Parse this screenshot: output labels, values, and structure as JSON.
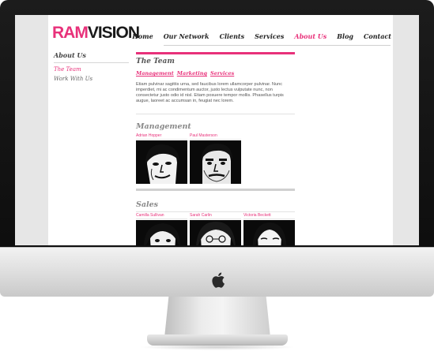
{
  "site": {
    "logo_primary": "RAM",
    "logo_secondary": "VISION",
    "brand_color": "#e8317a"
  },
  "nav": {
    "items": [
      {
        "label": "Home",
        "active": false
      },
      {
        "label": "Our Network",
        "active": false
      },
      {
        "label": "Clients",
        "active": false
      },
      {
        "label": "Services",
        "active": false
      },
      {
        "label": "About Us",
        "active": true
      },
      {
        "label": "Blog",
        "active": false
      },
      {
        "label": "Contact",
        "active": false
      }
    ]
  },
  "sidebar": {
    "title": "About Us",
    "items": [
      {
        "label": "The Team",
        "active": true
      },
      {
        "label": "Work With Us",
        "active": false
      }
    ]
  },
  "main": {
    "title": "The Team",
    "subnav": [
      "Management",
      "Marketing",
      "Services"
    ],
    "intro": "Etiam pulvinar sagittis urna, sed faucibus lorem ullamcorper pulvinar. Nunc imperdiet, mi ac condimentum auctor, justo lectus vulputate nunc, non consectetur justo odio id nisl. Etiam posuere tempor mollis. Phasellus turpis augue, laoreet ac accumsan in, feugiat nec lorem.",
    "management": {
      "title": "Management",
      "people": [
        {
          "name": "Adrian Hopper"
        },
        {
          "name": "Paul Masterson"
        }
      ]
    },
    "sales": {
      "title": "Sales",
      "people": [
        {
          "name": "Camilla Sullivan"
        },
        {
          "name": "Sarah Carlin"
        },
        {
          "name": "Victoria Beckett"
        }
      ]
    }
  }
}
